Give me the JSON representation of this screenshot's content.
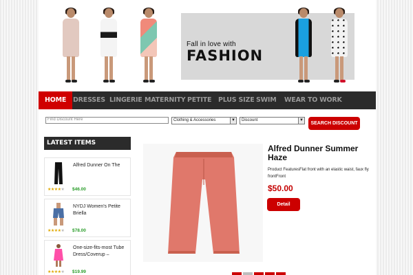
{
  "header": {
    "banner_small": "Fall in love with",
    "banner_big": "FASHION"
  },
  "nav": {
    "items": [
      "HOME",
      "DRESSES",
      "LINGERIE",
      "MATERNITY",
      "PETITE",
      "PLUS SIZE",
      "SWIM",
      "WEAR TO WORK"
    ],
    "active_index": 0
  },
  "search": {
    "placeholder": "Find Discount Here",
    "category_selected": "Clothing & Accessories",
    "discount_selected": "Discount",
    "button_label": "SEARCH DISCOUNT"
  },
  "sidebar": {
    "title": "LATEST ITEMS",
    "items": [
      {
        "title": "Alfred Dunner On The",
        "price": "$46.00",
        "rating": 4,
        "thumb": "black-pants"
      },
      {
        "title": "NYDJ Women's Petite Briella",
        "price": "$78.00",
        "rating": 4,
        "thumb": "denim-shorts"
      },
      {
        "title": "One-size-fits-most Tube Dress/Coverup –",
        "price": "$19.99",
        "rating": 4,
        "thumb": "pink-dress"
      }
    ]
  },
  "product": {
    "title": "Alfred Dunner Summer Haze",
    "description": "Product FeaturesFlat front with an elastic waist, faux fly frontFront",
    "price": "$50.00",
    "detail_label": "Detail",
    "image": "coral-capri-pants"
  },
  "colors": {
    "accent": "#cc0000",
    "nav_bg": "#2b2b2b",
    "price_green": "#2a9d2a"
  }
}
